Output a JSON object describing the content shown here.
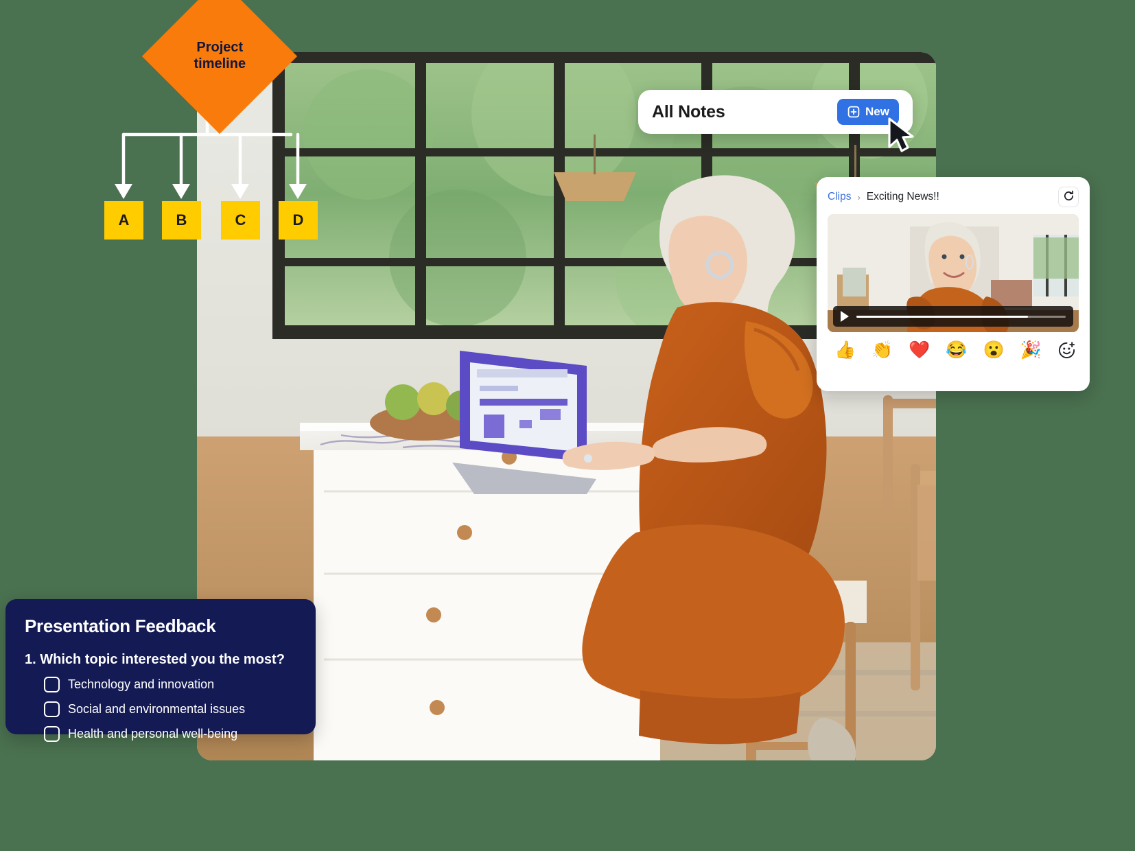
{
  "theme": {
    "background": "#4a7150",
    "accent_orange": "#f97b0c",
    "accent_yellow": "#ffcc00",
    "accent_blue": "#3072e3",
    "card_navy": "#141a54",
    "link_blue": "#3a6fd8"
  },
  "flowchart": {
    "root_label": "Project\ntimeline",
    "nodes": [
      {
        "label": "A"
      },
      {
        "label": "B"
      },
      {
        "label": "C"
      },
      {
        "label": "D"
      }
    ]
  },
  "notes_card": {
    "title": "All Notes",
    "new_button_label": "New",
    "new_button_icon": "note-plus-icon"
  },
  "cursor": {
    "icon": "mouse-pointer-icon"
  },
  "clips_panel": {
    "breadcrumb": {
      "parent": "Clips",
      "separator": "›",
      "current": "Exciting News!!"
    },
    "refresh_icon": "refresh-icon",
    "video": {
      "play_icon": "play-icon",
      "progress_percent": 82
    },
    "reactions": [
      {
        "name": "thumbs-up-emoji",
        "glyph": "👍"
      },
      {
        "name": "clap-emoji",
        "glyph": "👏"
      },
      {
        "name": "heart-emoji",
        "glyph": "❤️"
      },
      {
        "name": "joy-emoji",
        "glyph": "😂"
      },
      {
        "name": "open-mouth-emoji",
        "glyph": "😮"
      },
      {
        "name": "party-popper-emoji",
        "glyph": "🎉"
      }
    ],
    "add_reaction_icon": "add-reaction-icon"
  },
  "feedback_card": {
    "title": "Presentation Feedback",
    "question": "1. Which topic interested you the most?",
    "options": [
      "Technology and innovation",
      "Social and environmental issues",
      "Health and personal well-being"
    ]
  }
}
